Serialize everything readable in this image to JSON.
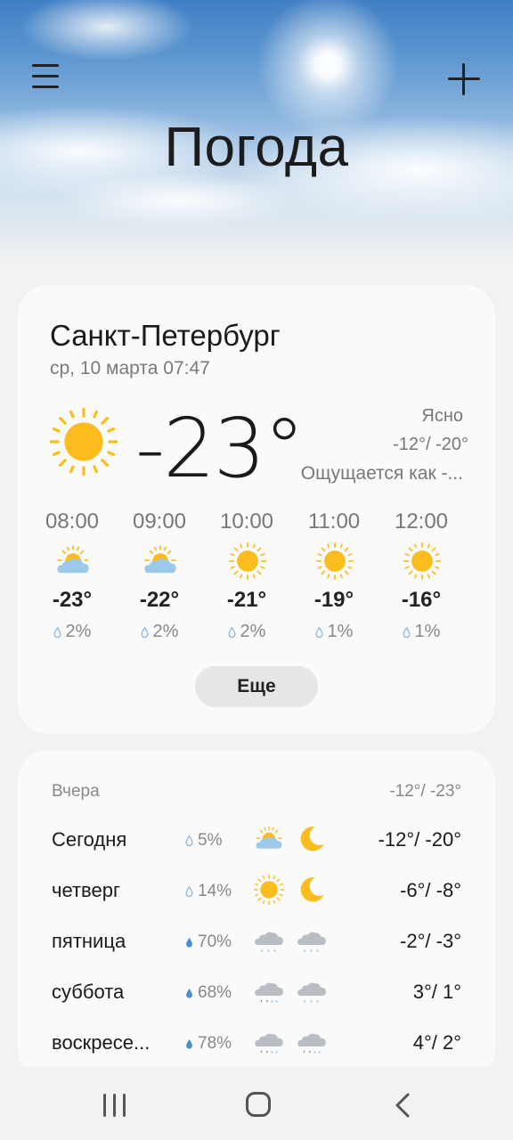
{
  "header": {
    "title": "Погода",
    "menu_icon": "hamburger-menu-icon",
    "add_icon": "plus-icon"
  },
  "current": {
    "city": "Санкт-Петербург",
    "datetime": "ср, 10 марта 07:47",
    "temperature": "-23°",
    "condition": "Ясно",
    "range": "-12°/ -20°",
    "feels_like": "Ощущается как -...",
    "icon": "sun-icon",
    "more_label": "Еще"
  },
  "hourly": [
    {
      "time": "08:00",
      "temp": "-23°",
      "precip": "2%",
      "icon": "partly-cloudy-icon"
    },
    {
      "time": "09:00",
      "temp": "-22°",
      "precip": "2%",
      "icon": "partly-cloudy-icon"
    },
    {
      "time": "10:00",
      "temp": "-21°",
      "precip": "2%",
      "icon": "sun-icon"
    },
    {
      "time": "11:00",
      "temp": "-19°",
      "precip": "1%",
      "icon": "sun-icon"
    },
    {
      "time": "12:00",
      "temp": "-16°",
      "precip": "1%",
      "icon": "sun-icon"
    }
  ],
  "daily": {
    "yesterday": {
      "label": "Вчера",
      "range": "-12°/ -23°"
    },
    "days": [
      {
        "day": "Сегодня",
        "precip": "5%",
        "day_icon": "partly-cloudy-icon",
        "night_icon": "moon-icon",
        "range": "-12°/ -20°"
      },
      {
        "day": "четверг",
        "precip": "14%",
        "day_icon": "sun-icon",
        "night_icon": "moon-icon",
        "range": "-6°/ -8°"
      },
      {
        "day": "пятница",
        "precip": "70%",
        "day_icon": "snow-cloud-icon",
        "night_icon": "snow-cloud-icon",
        "range": "-2°/ -3°"
      },
      {
        "day": "суббота",
        "precip": "68%",
        "day_icon": "sleet-cloud-icon",
        "night_icon": "snow-cloud-icon",
        "range": "3°/ 1°"
      },
      {
        "day": "воскресе...",
        "precip": "78%",
        "day_icon": "sleet-cloud-icon",
        "night_icon": "sleet-cloud-icon",
        "range": "4°/ 2°"
      }
    ]
  },
  "colors": {
    "sun": "#fbbd1e",
    "cloud": "#9cc8ea",
    "snow_cloud": "#b9bec4",
    "drop": "#7ab0de"
  }
}
